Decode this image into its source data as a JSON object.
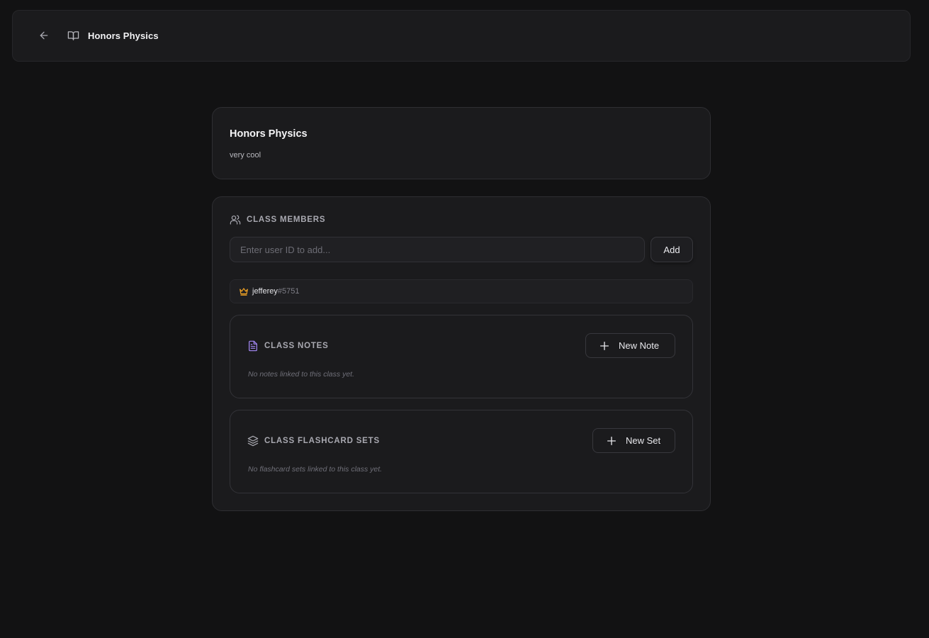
{
  "topbar": {
    "title": "Honors Physics",
    "back_icon": "arrow-left-icon",
    "book_icon": "book-open-icon"
  },
  "class_info": {
    "name": "Honors Physics",
    "description": "very cool"
  },
  "members": {
    "heading": "CLASS MEMBERS",
    "heading_icon": "users-icon",
    "input_placeholder": "Enter user ID to add...",
    "add_label": "Add",
    "list": [
      {
        "name": "jefferey",
        "tag": "#5751",
        "role_icon": "crown-icon",
        "role_color": "#f5a524"
      }
    ]
  },
  "notes": {
    "heading": "CLASS NOTES",
    "heading_icon": "file-text-icon",
    "icon_color": "#a78bfa",
    "new_label": "New Note",
    "empty": "No notes linked to this class yet."
  },
  "flashcards": {
    "heading": "CLASS FLASHCARD SETS",
    "heading_icon": "layers-icon",
    "new_label": "New Set",
    "empty": "No flashcard sets linked to this class yet."
  },
  "colors": {
    "background": "#121213",
    "card": "#1b1b1d",
    "border": "#2e2e32",
    "accent_purple": "#a78bfa",
    "crown_gold": "#f5a524"
  }
}
